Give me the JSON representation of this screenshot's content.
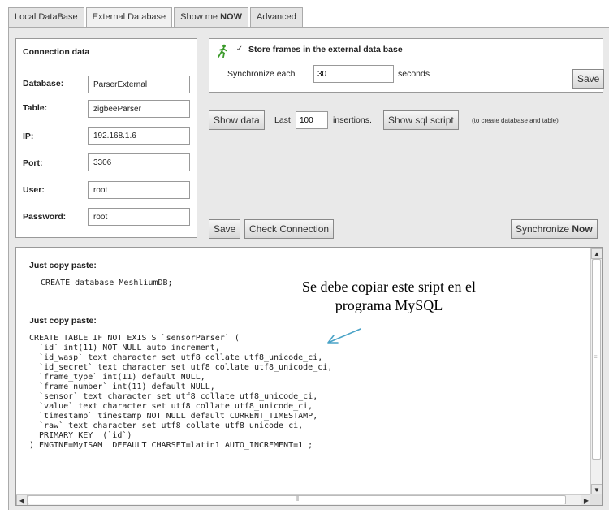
{
  "tabs": [
    {
      "label": "Local DataBase"
    },
    {
      "label": "External Database"
    },
    {
      "label_prefix": "Show me ",
      "label_bold": "NOW"
    },
    {
      "label": "Advanced"
    }
  ],
  "connection": {
    "title": "Connection data",
    "fields": {
      "database": {
        "label": "Database:",
        "value": "ParserExternal"
      },
      "table": {
        "label": "Table:",
        "value": "zigbeeParser"
      },
      "ip": {
        "label": "IP:",
        "value": "192.168.1.6"
      },
      "port": {
        "label": "Port:",
        "value": "3306"
      },
      "user": {
        "label": "User:",
        "value": "root"
      },
      "password": {
        "label": "Password:",
        "value": "root"
      }
    }
  },
  "store": {
    "checkbox_checked": true,
    "label": "Store frames in the external data base",
    "sync_prefix": "Synchronize each",
    "sync_value": "30",
    "sync_unit": "seconds",
    "save_label": "Save"
  },
  "show": {
    "show_data_label": "Show data",
    "last_label": "Last",
    "last_value": "100",
    "insertions_label": "insertions.",
    "show_sql_label": "Show sql script",
    "sql_note": "(to create database and table)"
  },
  "actions": {
    "save_label": "Save",
    "check_label": "Check Connection",
    "sync_prefix": "Synchronize ",
    "sync_bold": "Now"
  },
  "sql": {
    "heading1": "Just copy paste:",
    "code1": "CREATE database MeshliumDB;",
    "heading2": "Just copy paste:",
    "code2": "CREATE TABLE IF NOT EXISTS `sensorParser` (\n  `id` int(11) NOT NULL auto_increment,\n  `id_wasp` text character set utf8 collate utf8_unicode_ci,\n  `id_secret` text character set utf8 collate utf8_unicode_ci,\n  `frame_type` int(11) default NULL,\n  `frame_number` int(11) default NULL,\n  `sensor` text character set utf8 collate utf8_unicode_ci,\n  `value` text character set utf8 collate utf8_unicode_ci,\n  `timestamp` timestamp NOT NULL default CURRENT_TIMESTAMP,\n  `raw` text character set utf8 collate utf8_unicode_ci,\n  PRIMARY KEY  (`id`)\n) ENGINE=MyISAM  DEFAULT CHARSET=latin1 AUTO_INCREMENT=1 ;"
  },
  "annotation": {
    "line1": "Se debe copiar este sript en el",
    "line2": "programa MySQL"
  },
  "colors": {
    "panel": "#e9e9e9",
    "annotation_arrow": "#4aa3c7",
    "runner_icon": "#3a9a2a"
  }
}
